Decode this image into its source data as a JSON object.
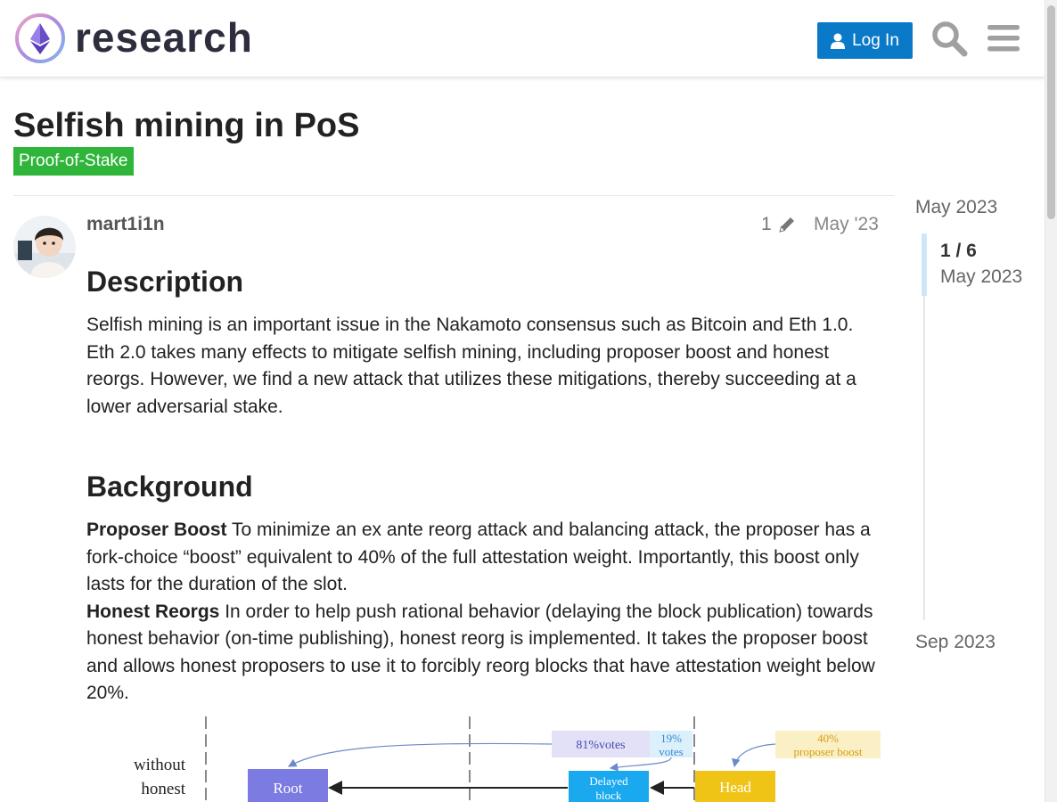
{
  "header": {
    "logo_text": "research",
    "login_label": "Log In",
    "search_icon": "search-icon",
    "menu_icon": "hamburger-menu-icon"
  },
  "topic": {
    "title": "Selfish mining in PoS",
    "category": "Proof-of-Stake"
  },
  "post": {
    "username": "mart1i1n",
    "edit_count": "1",
    "date": "May '23",
    "sections": {
      "description_heading": "Description",
      "description_text": "Selfish mining is an important issue in the Nakamoto consensus such as Bitcoin and Eth 1.0. Eth 2.0 takes many effects to mitigate selfish mining, including proposer boost and honest reorgs. However, we find a new attack that utilizes these mitigations, thereby succeeding at a lower adversarial stake.",
      "background_heading": "Background",
      "proposer_boost_label": "Proposer Boost",
      "proposer_boost_text": " To minimize an ex ante reorg attack and balancing attack, the proposer has a fork-choice “boost” equivalent to 40% of the full attestation weight. Importantly, this boost only lasts for the duration of the slot.",
      "honest_reorgs_label": "Honest Reorgs",
      "honest_reorgs_text": " In order to help push rational behavior (delaying the block publication) towards honest behavior (on-time publishing), honest reorg is implemented. It takes the proposer boost and allows honest proposers to use it to forcibly reorg blocks that have attestation weight below 20%."
    },
    "diagram": {
      "row_label_1": "without",
      "row_label_2": "honest",
      "votes_81": "81%votes",
      "votes_19_a": "19%",
      "votes_19_b": "votes",
      "boost_40_a": "40%",
      "boost_40_b": "proposer boost",
      "root": "Root",
      "delayed_a": "Delayed",
      "delayed_b": "block",
      "head": "Head"
    }
  },
  "timeline": {
    "start": "May 2023",
    "position": "1 / 6",
    "position_date": "May 2023",
    "end": "Sep 2023"
  }
}
